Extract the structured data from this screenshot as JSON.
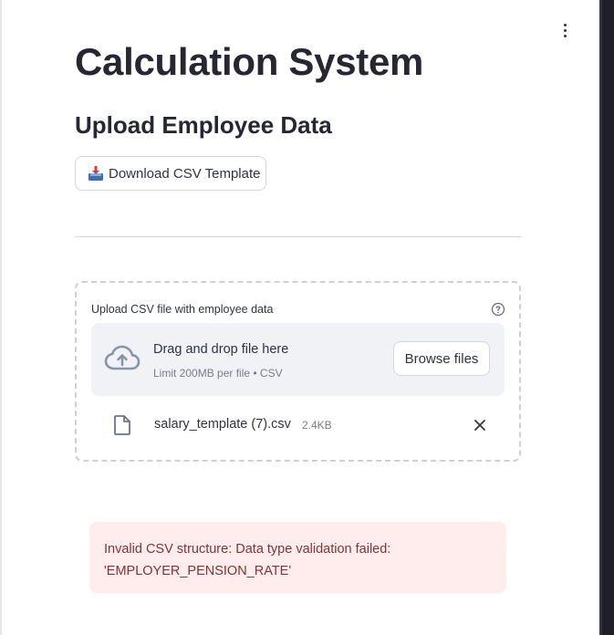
{
  "page": {
    "title": "Calculation System",
    "section_title": "Upload Employee Data"
  },
  "download": {
    "label": "Download CSV Template",
    "icon": "inbox-tray-icon"
  },
  "uploader": {
    "label": "Upload CSV file with employee data",
    "dropzone_title": "Drag and drop file here",
    "dropzone_limit": "Limit 200MB per file • CSV",
    "browse_label": "Browse files",
    "file": {
      "name": "salary_template (7).csv",
      "size": "2.4KB"
    }
  },
  "error": {
    "line1": "Invalid CSV structure: Data type validation failed:",
    "line2": "'EMPLOYER_PENSION_RATE'"
  },
  "colors": {
    "error_bg": "#ffecec",
    "error_text": "#7d353b",
    "dropzone_bg": "#f0f2f6"
  }
}
